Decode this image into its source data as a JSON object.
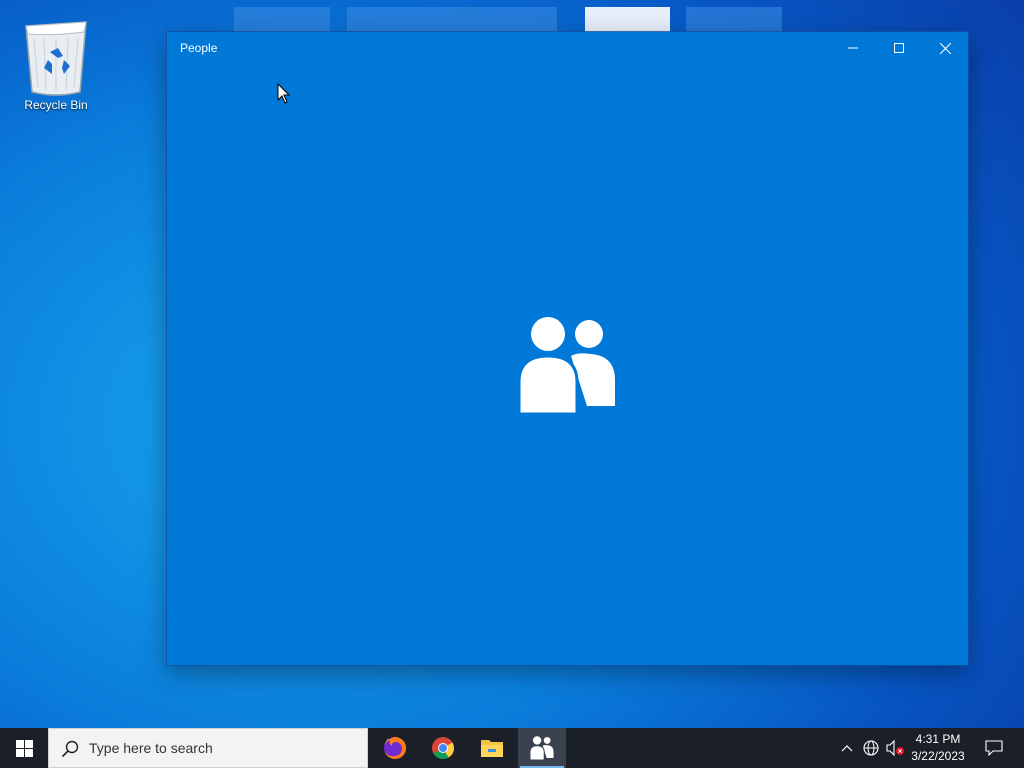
{
  "desktop": {
    "icons": [
      {
        "label": "Recycle Bin",
        "icon": "recycle-bin-icon"
      }
    ]
  },
  "window": {
    "title": "People",
    "background": "#0078d7",
    "controls": {
      "minimize": "minimize-icon",
      "maximize": "maximize-icon",
      "close": "close-icon"
    },
    "splash_icon": "people-icon"
  },
  "taskbar": {
    "start_icon": "windows-logo-icon",
    "search": {
      "placeholder": "Type here to search",
      "icon": "search-icon"
    },
    "apps": [
      {
        "name": "Firefox",
        "icon": "firefox-icon",
        "active": false
      },
      {
        "name": "Google Chrome",
        "icon": "chrome-icon",
        "active": false
      },
      {
        "name": "File Explorer",
        "icon": "file-explorer-icon",
        "active": false
      },
      {
        "name": "People",
        "icon": "people-icon",
        "active": true
      }
    ],
    "tray": {
      "icons": [
        "chevron-up-icon",
        "network-icon",
        "volume-muted-icon"
      ],
      "time": "4:31 PM",
      "date": "3/22/2023",
      "notification_icon": "action-center-icon"
    }
  }
}
